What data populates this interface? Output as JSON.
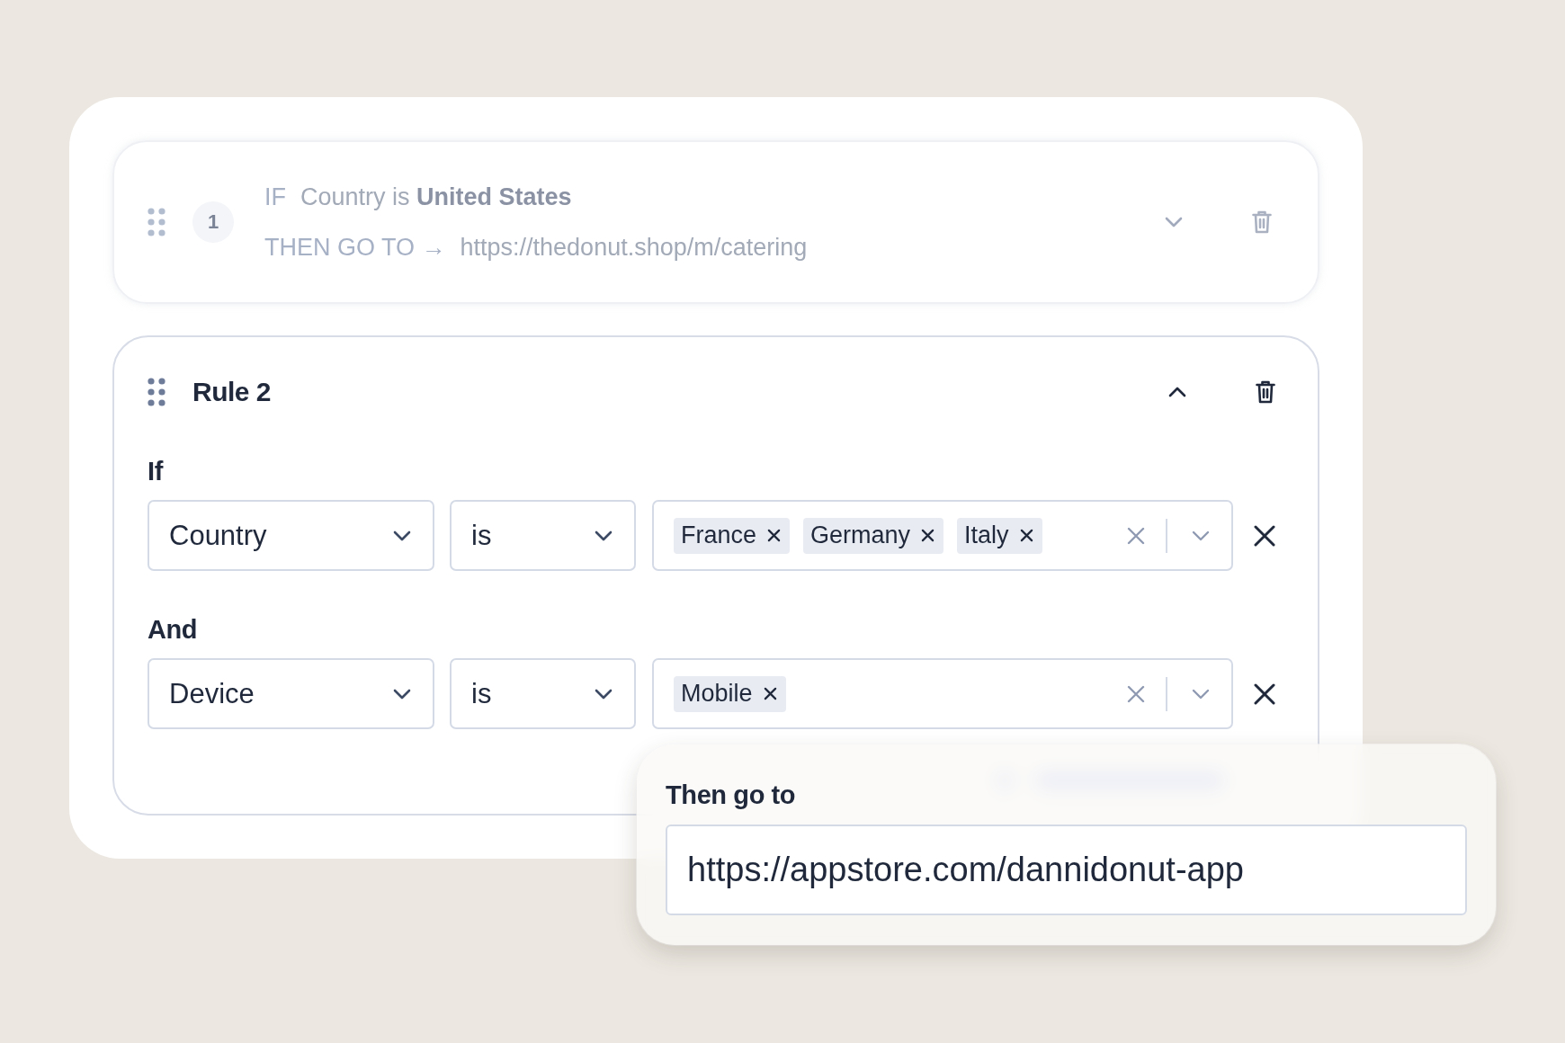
{
  "rules": [
    {
      "kind": "summary",
      "dimmed": true,
      "expanded": false,
      "number": "1",
      "if_label": "IF",
      "condition": "Country is **United States**",
      "then_label": "THEN GO TO →",
      "url": "https://thedonut.shop/m/catering"
    },
    {
      "kind": "editor",
      "dimmed": false,
      "expanded": true,
      "title": "Rule 2",
      "conditions": [
        {
          "label": "If",
          "field": "Country",
          "operator": "is",
          "values": [
            "France",
            "Germany",
            "Italy"
          ]
        },
        {
          "label": "And",
          "field": "Device",
          "operator": "is",
          "values": [
            "Mobile"
          ]
        }
      ]
    }
  ],
  "destination": {
    "label": "Then go to",
    "value": "https://appstore.com/dannidonut-app"
  }
}
